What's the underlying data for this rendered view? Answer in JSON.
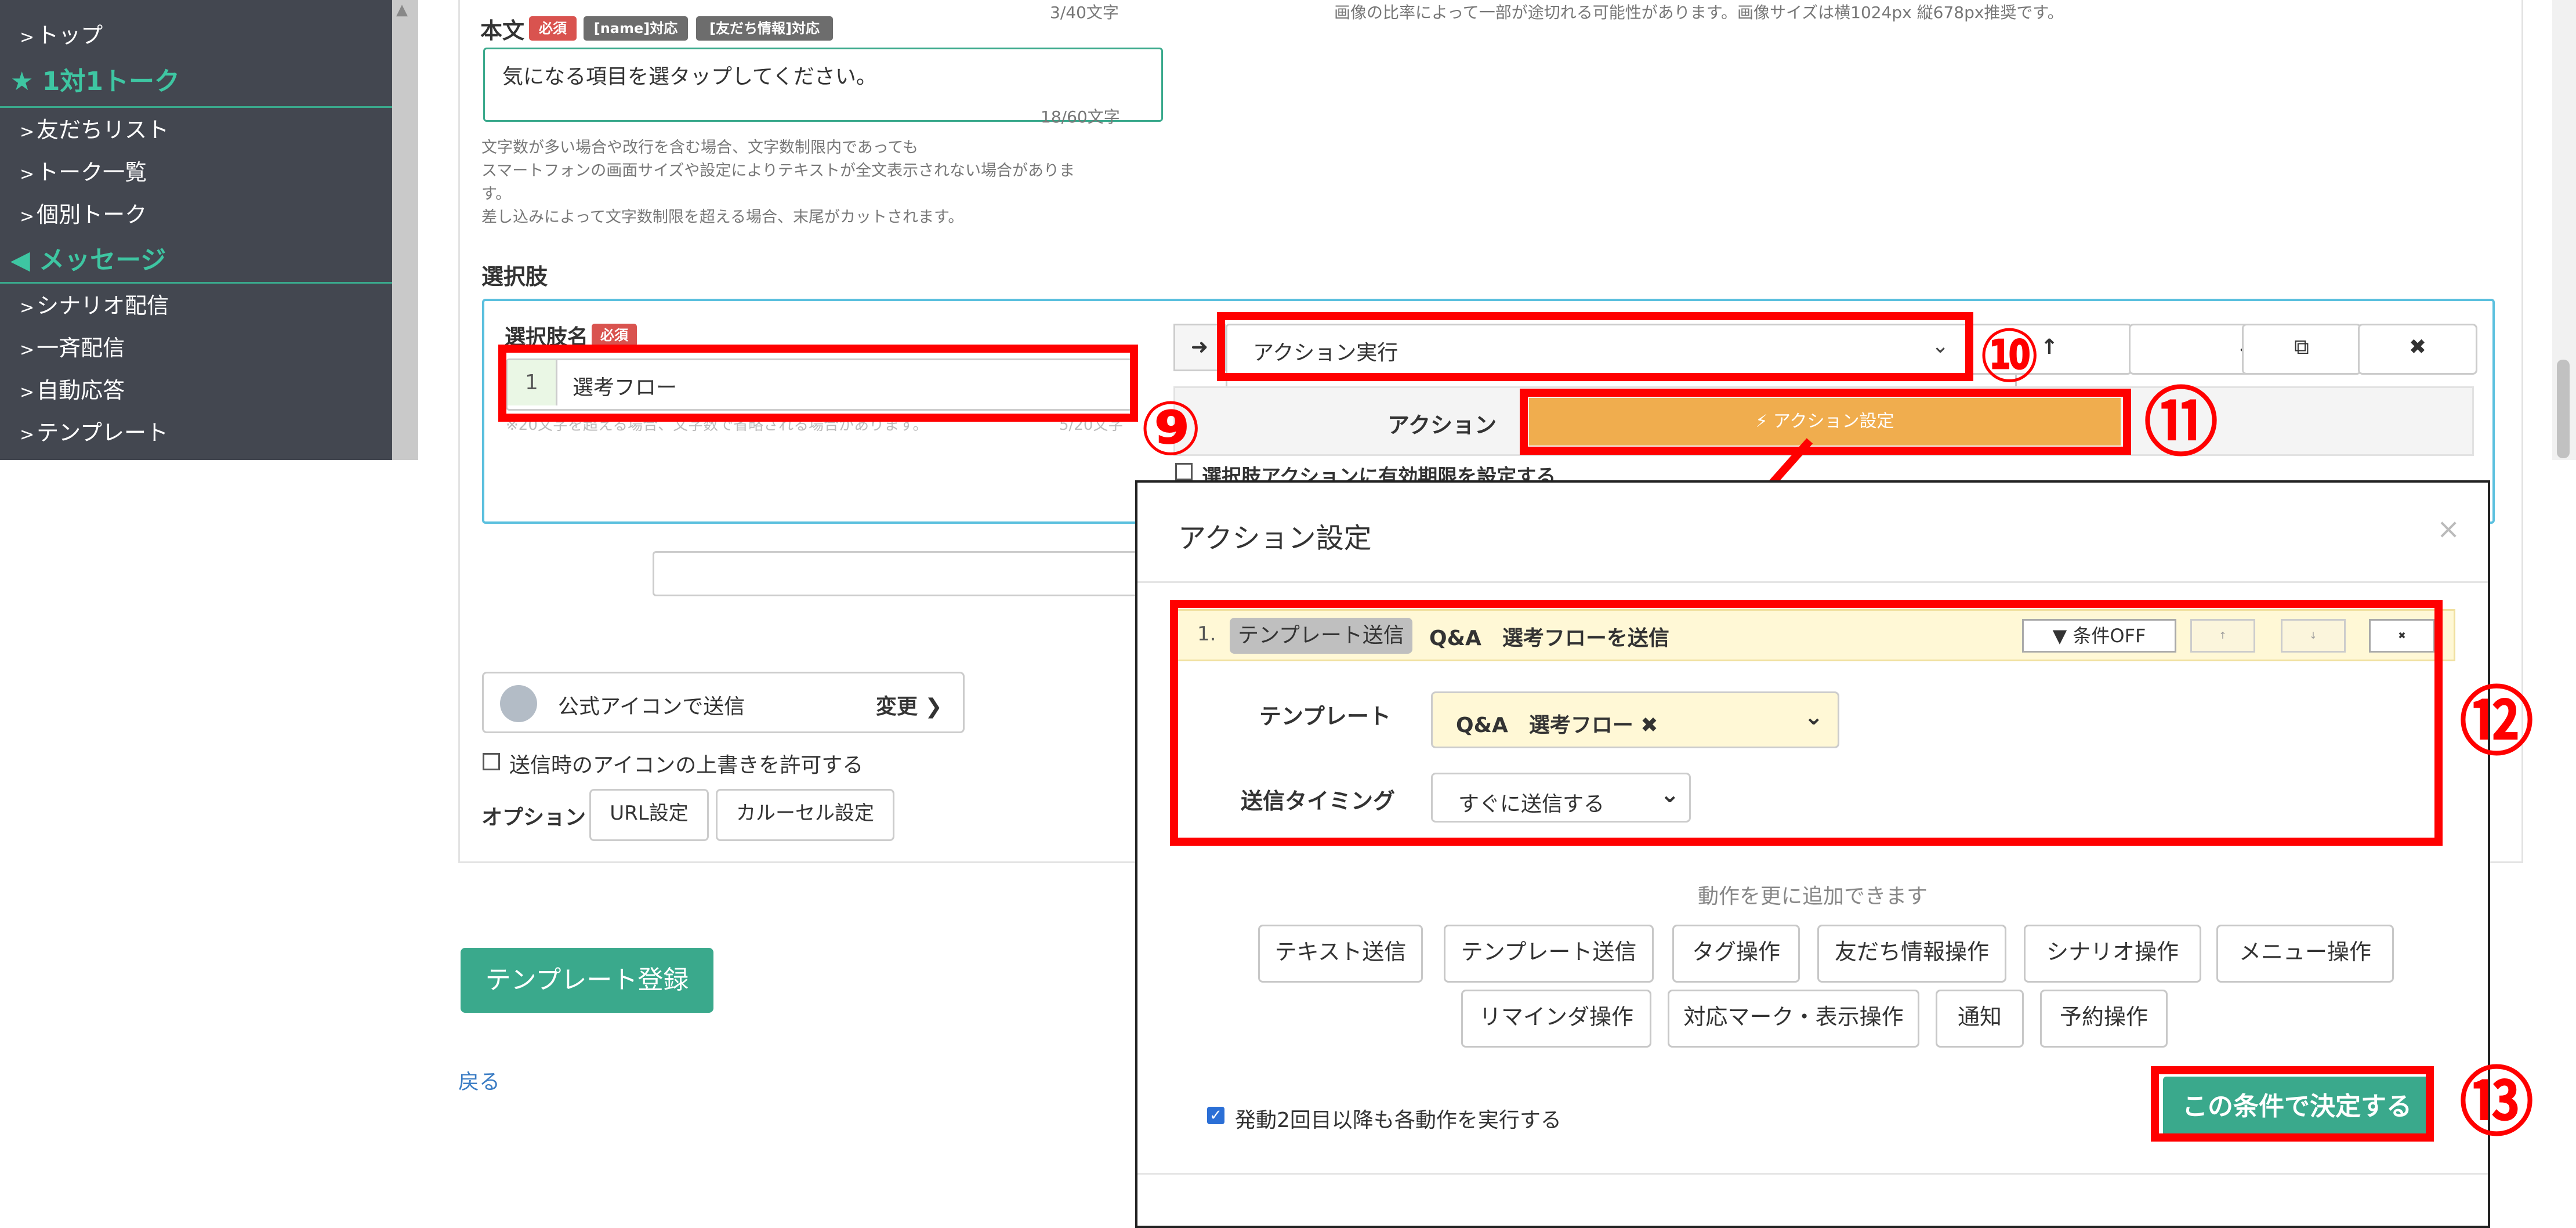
{
  "sidebar": {
    "items": [
      {
        "label": "トップ"
      },
      {
        "label": "友だちリスト"
      },
      {
        "label": "トーク一覧"
      },
      {
        "label": "個別トーク"
      },
      {
        "label": "シナリオ配信"
      },
      {
        "label": "一斉配信"
      },
      {
        "label": "自動応答"
      },
      {
        "label": "テンプレート"
      }
    ],
    "sections": [
      {
        "label": "1対1トーク",
        "icon": "star-icon"
      },
      {
        "label": "メッセージ",
        "icon": "megaphone-icon"
      }
    ],
    "chevron": ">"
  },
  "body_text": {
    "label": "本文",
    "required_badge": "必須",
    "name_badge": "[name]対応",
    "friend_badge": "[友だち情報]対応",
    "top_counter": "3/40文字",
    "value": "気になる項目を選タップしてください。",
    "counter": "18/60文字",
    "note_lines": [
      "文字数が多い場合や改行を含む場合、文字数制限内であっても",
      "スマートフォンの画面サイズや設定によりテキストが全文表示されない場合がありま",
      "す。",
      "差し込みによって文字数制限を超える場合、末尾がカットされます。"
    ],
    "image_note": "画像の比率によって一部が途切れる可能性があります。画像サイズは横1024px 縦678px推奨です。"
  },
  "choices": {
    "section_label": "選択肢",
    "name_label": "選択肢名",
    "required_badge": "必須",
    "number": "1",
    "value": "選考フロー",
    "hint": "※20文字を超える場合、文字数で省略される場合があります。",
    "counter": "5/20文字",
    "action_select": "アクション実行",
    "action_label": "アクション",
    "action_button": "⚡ アクション設定",
    "expiry_checkbox": "選択肢アクションに有効期限を設定する"
  },
  "sender": {
    "label": "公式アイコンで送信",
    "change": "変更",
    "override_checkbox": "送信時のアイコンの上書きを許可する",
    "option_label": "オプション",
    "url_button": "URL設定",
    "carousel_button": "カルーセル設定"
  },
  "register_button": "テンプレート登録",
  "back_link": "戻る",
  "modal": {
    "title": "アクション設定",
    "row": {
      "index": "1.",
      "tag": "テンプレート送信",
      "text": "Q&A　選考フローを送信",
      "condition": "条件OFF"
    },
    "template_label": "テンプレート",
    "template_value": "Q&A　選考フロー",
    "timing_label": "送信タイミング",
    "timing_value": "すぐに送信する",
    "more_text": "動作を更に追加できます",
    "actions_row1": [
      "テキスト送信",
      "テンプレート送信",
      "タグ操作",
      "友だち情報操作",
      "シナリオ操作",
      "メニュー操作"
    ],
    "actions_row2": [
      "リマインダ操作",
      "対応マーク・表示操作",
      "通知",
      "予約操作"
    ],
    "repeat_checkbox": "発動2回目以降も各動作を実行する",
    "confirm_button": "この条件で決定する"
  },
  "callouts": [
    "⑨",
    "⑩",
    "⑪",
    "⑫",
    "⑬"
  ],
  "colors": {
    "sidebar_bg": "#434750",
    "accent_green": "#3ec6a2",
    "teal_button": "#3aa98c",
    "action_orange": "#f0ad4e",
    "annotation_red": "#ff0000",
    "highlight_yellow": "#fff8d6"
  }
}
